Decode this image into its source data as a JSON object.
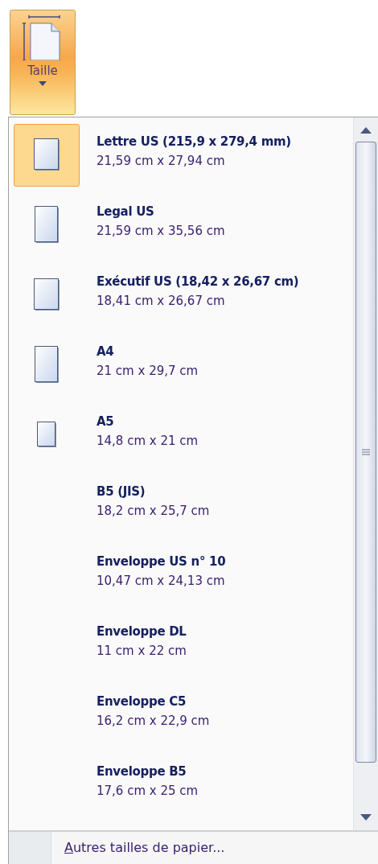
{
  "ribbon_button": {
    "label": "Taille",
    "selected": true
  },
  "menu": {
    "items": [
      {
        "title": "Lettre US (215,9 x 279,4 mm)",
        "size": "21,59 cm x 27,94 cm",
        "kind": "page",
        "selected": true
      },
      {
        "title": "Legal US",
        "size": "21,59 cm x 35,56 cm",
        "kind": "page-tall",
        "selected": false
      },
      {
        "title": "Exécutif US (18,42 x 26,67 cm)",
        "size": "18,41 cm x 26,67 cm",
        "kind": "page",
        "selected": false
      },
      {
        "title": "A4",
        "size": "21 cm x 29,7 cm",
        "kind": "page-tall",
        "selected": false
      },
      {
        "title": "A5",
        "size": "14,8 cm x 21 cm",
        "kind": "page-small",
        "selected": false
      },
      {
        "title": "B5 (JIS)",
        "size": "18,2 cm x 25,7 cm",
        "kind": "none",
        "selected": false
      },
      {
        "title": "Enveloppe US n° 10",
        "size": "10,47 cm x 24,13 cm",
        "kind": "none",
        "selected": false
      },
      {
        "title": "Enveloppe DL",
        "size": "11 cm x 22 cm",
        "kind": "none",
        "selected": false
      },
      {
        "title": "Enveloppe C5",
        "size": "16,2 cm x 22,9 cm",
        "kind": "none",
        "selected": false
      },
      {
        "title": "Enveloppe B5",
        "size": "17,6 cm x 25 cm",
        "kind": "none",
        "selected": false
      }
    ],
    "footer": {
      "access_key": "A",
      "label_rest": "utres tailles de papier..."
    }
  }
}
